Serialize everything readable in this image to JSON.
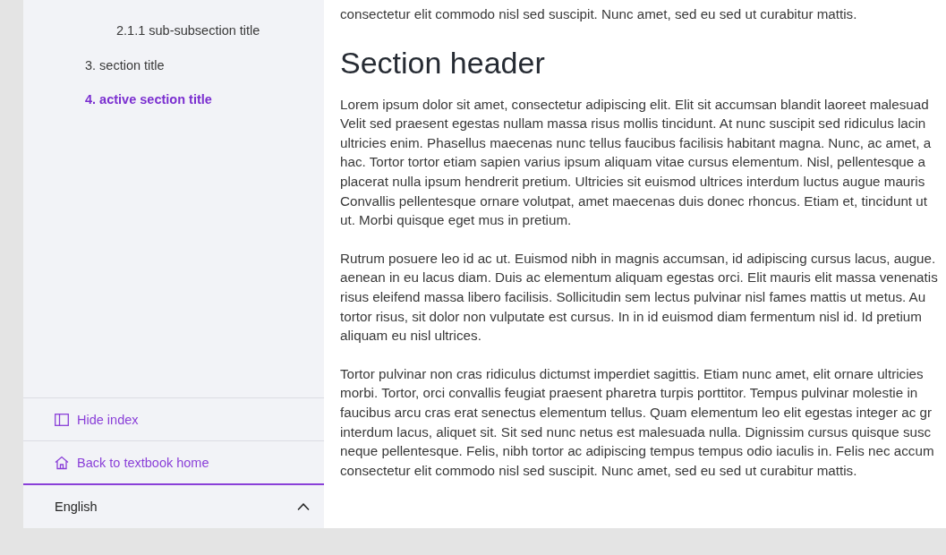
{
  "sidebar": {
    "items": [
      {
        "kind": "subsubsection",
        "label": "2.1.1 sub-subsection title",
        "selected": false
      },
      {
        "kind": "section",
        "label": "3. section title",
        "selected": false
      },
      {
        "kind": "section",
        "label": "4. active section title",
        "selected": true
      }
    ],
    "actions": [
      {
        "kind": "panel",
        "label": "Hide index"
      },
      {
        "kind": "home",
        "label": "Back to textbook home"
      }
    ],
    "language": {
      "value": "English",
      "expanded": true
    }
  },
  "content": {
    "intro": "consectetur elit commodo nisl sed suscipit. Nunc amet, sed eu sed ut curabitur mattis.",
    "heading": "Section header",
    "paragraphs": [
      "Lorem ipsum dolor sit amet, consectetur adipiscing elit. Elit sit accumsan blandit laoreet malesuad\nVelit sed praesent egestas nullam massa risus mollis tincidunt. At nunc suscipit sed ridiculus lacin\nultricies enim. Phasellus maecenas nunc tellus faucibus facilisis habitant magna. Nunc, ac amet, a\nhac. Tortor tortor etiam sapien varius ipsum aliquam vitae cursus elementum. Nisl, pellentesque a\nplacerat nulla ipsum hendrerit pretium. Ultricies sit euismod ultrices interdum luctus augue mauris\nConvallis pellentesque ornare volutpat, amet maecenas duis donec rhoncus. Etiam et, tincidunt ut\nut. Morbi quisque eget mus in pretium.",
      "Rutrum posuere leo id ac ut. Euismod nibh in magnis accumsan, id adipiscing cursus lacus, augue.\naenean in eu lacus diam. Duis ac elementum aliquam egestas orci. Elit mauris elit massa venenatis\nrisus eleifend massa libero facilisis. Sollicitudin sem lectus pulvinar nisl fames mattis ut metus. Au\ntortor risus, sit dolor non vulputate est cursus. In in id euismod diam fermentum nisl id. Id pretium\naliquam eu nisl ultrices.",
      "Tortor pulvinar non cras ridiculus dictumst imperdiet sagittis. Etiam nunc amet, elit ornare ultricies\nmorbi. Tortor, orci convallis feugiat praesent pharetra turpis porttitor. Tempus pulvinar molestie in\nfaucibus arcu cras erat senectus elementum tellus. Quam elementum leo elit egestas integer ac gr\ninterdum lacus, aliquet sit. Sit sed nunc netus est malesuada nulla. Dignissim cursus quisque susc\nneque pellentesque. Felis, nibh tortor ac adipiscing tempus tempus odio iaculis in. Felis nec accum\nconsectetur elit commodo nisl sed suscipit. Nunc amet, sed eu sed ut curabitur mattis."
    ]
  }
}
